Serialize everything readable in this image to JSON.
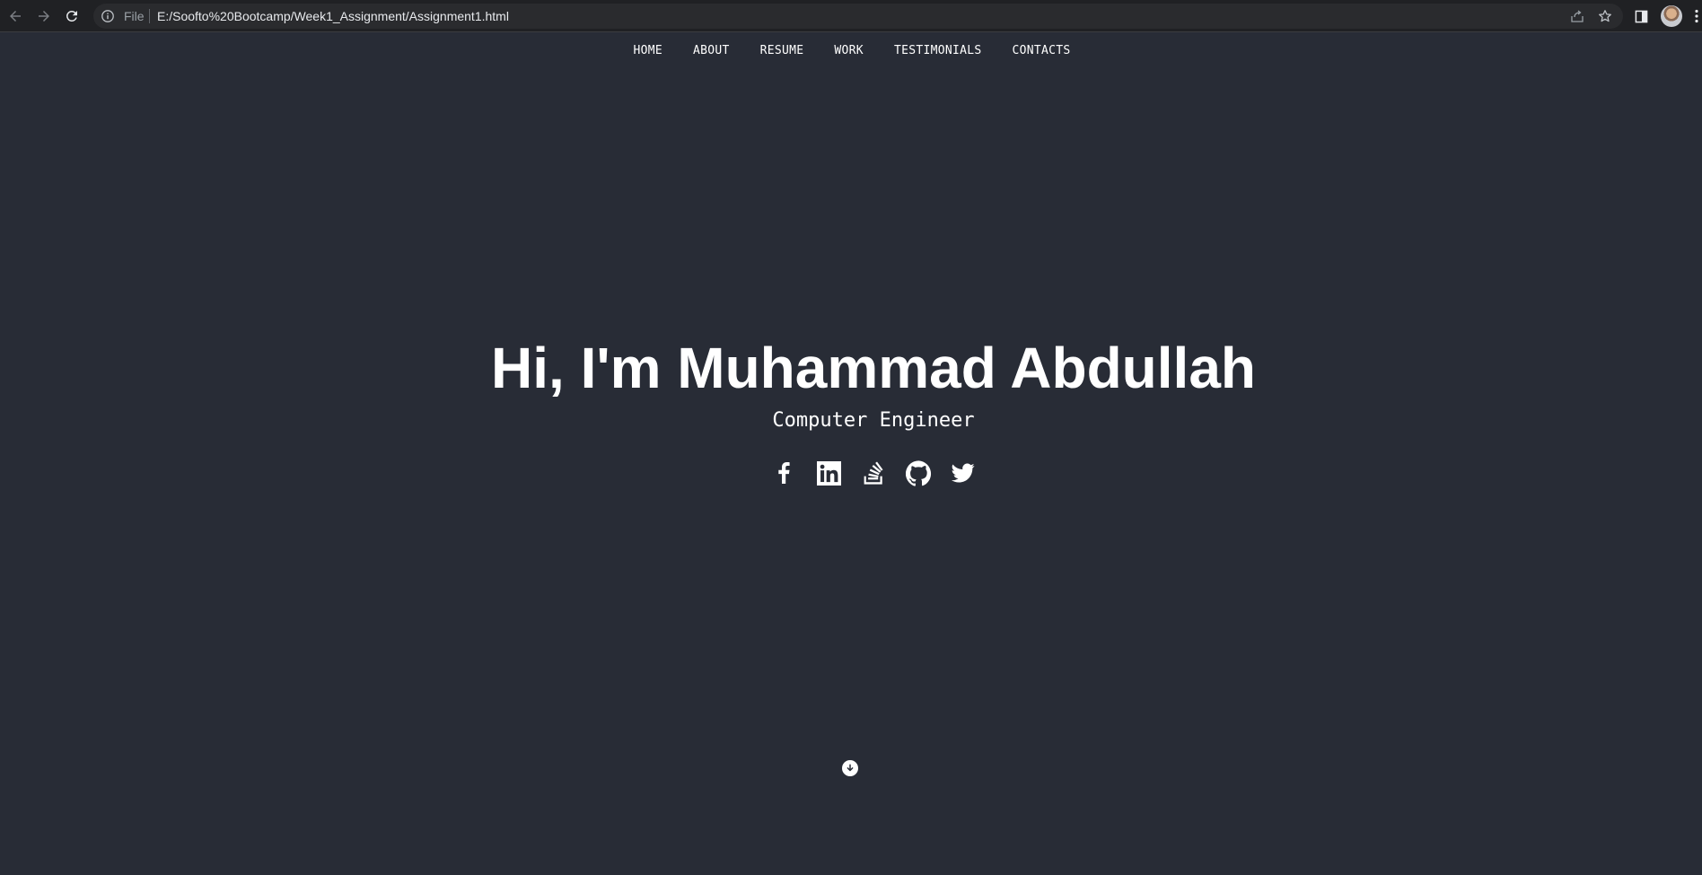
{
  "browser": {
    "omnibox": {
      "scheme_label": "File",
      "url": "E:/Soofto%20Bootcamp/Week1_Assignment/Assignment1.html"
    },
    "icons": [
      "back-icon",
      "forward-icon",
      "reload-icon",
      "info-icon",
      "share-icon",
      "star-icon",
      "side-panel-icon",
      "avatar",
      "menu-icon"
    ]
  },
  "nav": {
    "items": [
      {
        "label": "HOME"
      },
      {
        "label": "ABOUT"
      },
      {
        "label": "RESUME"
      },
      {
        "label": "WORK"
      },
      {
        "label": "TESTIMONIALS"
      },
      {
        "label": "CONTACTS"
      }
    ]
  },
  "hero": {
    "title": "Hi, I'm Muhammad Abdullah",
    "subtitle": "Computer Engineer",
    "socials": [
      "facebook-icon",
      "linkedin-icon",
      "stackoverflow-icon",
      "github-icon",
      "twitter-icon"
    ]
  },
  "scroll_indicator": "arrow-down-circle-icon",
  "colors": {
    "page_background": "#282c36",
    "text": "#ffffff",
    "chrome_background": "#202124",
    "omnibox_background": "#2a2b2e"
  }
}
